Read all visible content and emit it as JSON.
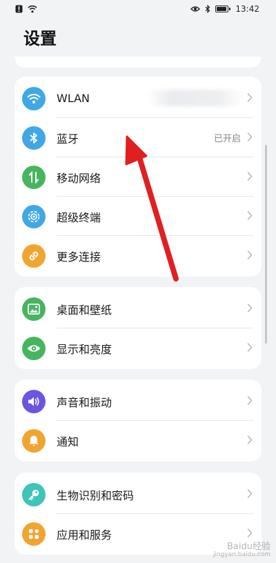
{
  "status_bar": {
    "time": "13:42",
    "battery_level": 0.9
  },
  "page": {
    "title": "设置"
  },
  "sections": [
    {
      "items": [
        {
          "label": "WLAN",
          "icon": "wifi-icon",
          "color": "#3fa8e5",
          "value": ""
        },
        {
          "label": "蓝牙",
          "icon": "bluetooth-icon",
          "color": "#3fa8e5",
          "value": "已开启"
        },
        {
          "label": "移动网络",
          "icon": "mobile-network-icon",
          "color": "#47b560",
          "value": ""
        },
        {
          "label": "超级终端",
          "icon": "super-device-icon",
          "color": "#3fa8e5",
          "value": ""
        },
        {
          "label": "更多连接",
          "icon": "link-icon",
          "color": "#f2a431",
          "value": ""
        }
      ]
    },
    {
      "items": [
        {
          "label": "桌面和壁纸",
          "icon": "wallpaper-icon",
          "color": "#47b560",
          "value": ""
        },
        {
          "label": "显示和亮度",
          "icon": "eye-icon",
          "color": "#47b560",
          "value": ""
        }
      ]
    },
    {
      "items": [
        {
          "label": "声音和振动",
          "icon": "sound-icon",
          "color": "#6c55e0",
          "value": ""
        },
        {
          "label": "通知",
          "icon": "bell-icon",
          "color": "#f2a431",
          "value": ""
        }
      ]
    },
    {
      "items": [
        {
          "label": "生物识别和密码",
          "icon": "key-icon",
          "color": "#3ec4b8",
          "value": ""
        },
        {
          "label": "应用和服务",
          "icon": "apps-icon",
          "color": "#f2a431",
          "value": ""
        }
      ]
    }
  ],
  "annotation": {
    "arrow_color": "#e02020"
  },
  "watermark": {
    "text": "Baidu经验",
    "sub": "jingyan.baidu.com"
  }
}
